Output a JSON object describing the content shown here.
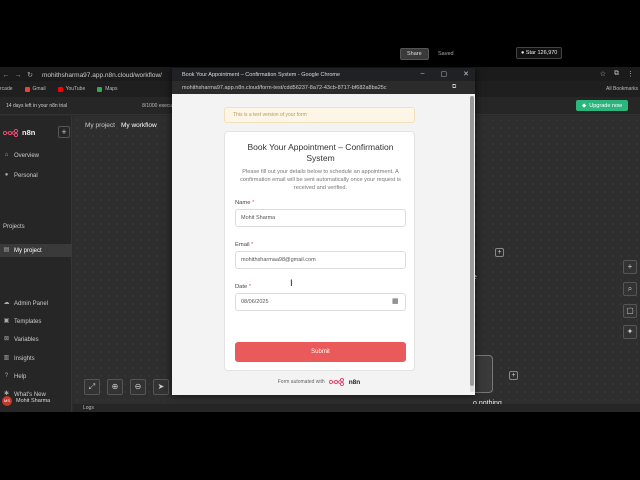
{
  "browser": {
    "url": "mohithsharma97.app.n8n.cloud/workflow/",
    "bookmarks": [
      {
        "label": "Gmail",
        "color": "#ea4335"
      },
      {
        "label": "YouTube",
        "color": "#ff0000"
      },
      {
        "label": "Maps",
        "color": "#34a853"
      }
    ],
    "bookmark_prefix": "rcade",
    "all_bookmarks": "All Bookmarks"
  },
  "n8n": {
    "trial_text": "14 days left in your n8n trial",
    "executions_text": "8/1000 executions",
    "upgrade_label": "Upgrade now",
    "logo_text": "n8n",
    "sidebar": {
      "overview": "Overview",
      "personal": "Personal",
      "projects_heading": "Projects",
      "my_project": "My project",
      "admin_panel": "Admin Panel",
      "templates": "Templates",
      "variables": "Variables",
      "insights": "Insights",
      "help": "Help",
      "whats_new": "What's New",
      "user_name": "Mohit Sharma",
      "user_initials": "MS"
    },
    "breadcrumb": [
      "My project",
      "My workflow"
    ],
    "share_label": "Share",
    "saved_label": "Saved",
    "github_label": "Star",
    "github_count": "126,970",
    "node_label": "o nothing",
    "node_label_top": "e",
    "logs_label": "Logs"
  },
  "popup": {
    "title": "Book Your Appointment – Confirmation System - Google Chrome",
    "url": "mohithsharma97.app.n8n.cloud/form-test/cdd56237-8a72-43cb-8717-bf682a8ba25c",
    "test_banner": "This is a test version of your form",
    "form_title": "Book Your Appointment – Confirmation System",
    "form_description": "Please fill out your details below to schedule an appointment. A confirmation email will be sent automatically once your request is received and verified.",
    "fields": {
      "name_label": "Name",
      "name_value": "Mohit Sharma",
      "email_label": "Email",
      "email_value": "mohithsharmaa98@gmail.com",
      "date_label": "Date",
      "date_value": "08/06/2025"
    },
    "required_mark": "*",
    "submit_label": "Submit",
    "footer_text": "Form automated with",
    "footer_logo": "n8n"
  },
  "colors": {
    "submit": "#eb5a5a",
    "upgrade": "#2cb67d",
    "n8n_logo": "#ea4b71"
  }
}
